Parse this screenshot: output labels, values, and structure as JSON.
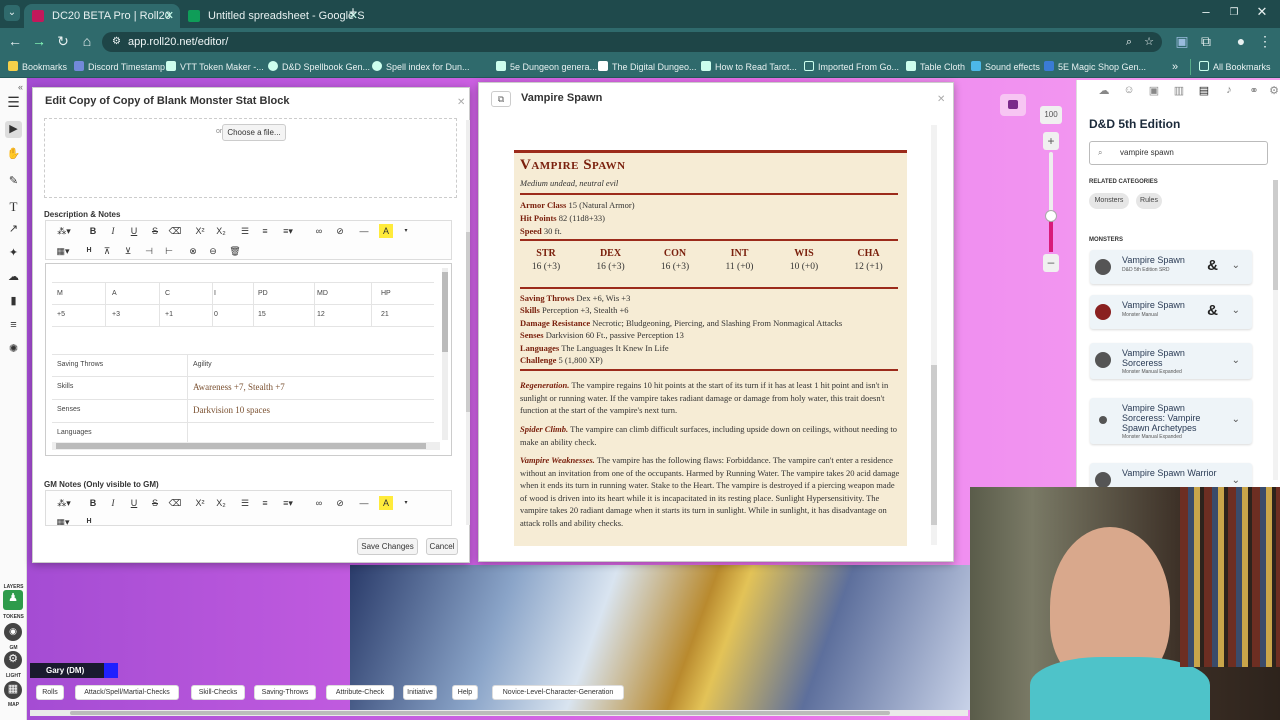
{
  "browser": {
    "tabs": [
      {
        "label": "DC20 BETA Pro | Roll20",
        "color": "#c2185b"
      },
      {
        "label": "Untitled spreadsheet - Google S",
        "color": "#0f9d58"
      }
    ],
    "new_tab": "+",
    "url": "app.roll20.net/editor/",
    "bookmarks": [
      "Bookmarks",
      "Discord Timestamp",
      "VTT Token Maker -...",
      "D&D Spellbook Gen...",
      "Spell index for Dun...",
      "5e Dungeon genera...",
      "The Digital Dungeo...",
      "How to Read Tarot...",
      "Imported From Go...",
      "Table Cloth",
      "Sound effects",
      "5E Magic Shop Gen...",
      "»",
      "All Bookmarks"
    ]
  },
  "editor": {
    "title": "Edit Copy of Copy of Blank Monster Stat Block",
    "or_label": "or",
    "choose_file": "Choose a file...",
    "desc_label": "Description & Notes",
    "table_headers": [
      "M",
      "A",
      "C",
      "I",
      "PD",
      "MD",
      "HP"
    ],
    "table_values": [
      "+5",
      "+3",
      "+1",
      "0",
      "15",
      "12",
      "21"
    ],
    "rows": [
      {
        "k": "Saving Throws",
        "v": "Agility"
      },
      {
        "k": "Skills",
        "v": "Awareness +7, Stealth +7"
      },
      {
        "k": "Senses",
        "v": "Darkvision 10 spaces"
      },
      {
        "k": "Languages",
        "v": ""
      }
    ],
    "gm_label": "GM Notes (Only visible to GM)",
    "save": "Save Changes",
    "cancel": "Cancel"
  },
  "handout": {
    "title": "Vampire Spawn",
    "name": "Vampire Spawn",
    "type": "Medium undead, neutral evil",
    "ac_k": "Armor Class",
    "ac_v": "15 (Natural Armor)",
    "hp_k": "Hit Points",
    "hp_v": "82 (11d8+33)",
    "sp_k": "Speed",
    "sp_v": "30 ft.",
    "abilities": [
      {
        "n": "STR",
        "v": "16 (+3)"
      },
      {
        "n": "DEX",
        "v": "16 (+3)"
      },
      {
        "n": "CON",
        "v": "16 (+3)"
      },
      {
        "n": "INT",
        "v": "11 (+0)"
      },
      {
        "n": "WIS",
        "v": "10 (+0)"
      },
      {
        "n": "CHA",
        "v": "12 (+1)"
      }
    ],
    "st_k": "Saving Throws",
    "st_v": "Dex +6, Wis +3",
    "sk_k": "Skills",
    "sk_v": "Perception +3, Stealth +6",
    "dr_k": "Damage Resistance",
    "dr_v": "Necrotic; Bludgeoning, Piercing, and Slashing From Nonmagical Attacks",
    "se_k": "Senses",
    "se_v": "Darkvision 60 Ft., passive Perception 13",
    "la_k": "Languages",
    "la_v": "The Languages It Knew In Life",
    "ch_k": "Challenge",
    "ch_v": "5 (1,800 XP)",
    "regen_k": "Regeneration.",
    "regen_v": "The vampire regains 10 hit points at the start of its turn if it has at least 1 hit point and isn't in sunlight or running water. If the vampire takes radiant damage or damage from holy water, this trait doesn't function at the start of the vampire's next turn.",
    "spider_k": "Spider Climb.",
    "spider_v": "The vampire can climb difficult surfaces, including upside down on ceilings, without needing to make an ability check.",
    "weak_k": "Vampire Weaknesses.",
    "weak_v": "The vampire has the following flaws: Forbiddance. The vampire can't enter a residence without an invitation from one of the occupants. Harmed by Running Water. The vampire takes 20 acid damage when it ends its turn in running water. Stake to the Heart. The vampire is destroyed if a piercing weapon made of wood is driven into its heart while it is incapacitated in its resting place. Sunlight Hypersensitivity. The vampire takes 20 radiant damage when it starts its turn in sunlight. While in sunlight, it has disadvantage on attack rolls and ability checks."
  },
  "zoom": "100",
  "compendium": {
    "title": "D&D 5th Edition",
    "search": "vampire spawn",
    "related": "RELATED CATEGORIES",
    "pills": [
      "Monsters",
      "Rules"
    ],
    "monsters_label": "MONSTERS",
    "cards": [
      {
        "name": "Vampire Spawn",
        "sub": "D&D 5th Edition SRD",
        "amp": true
      },
      {
        "name": "Vampire Spawn",
        "sub": "Monster Manual",
        "amp": true
      },
      {
        "name": "Vampire Spawn Sorceress",
        "sub": "Monster Manual Expanded",
        "amp": false
      },
      {
        "name": "Vampire Spawn Sorceress: Vampire Spawn Archetypes",
        "sub": "Monster Manual Expanded",
        "amp": false
      },
      {
        "name": "Vampire Spawn Warrior",
        "sub": "",
        "amp": false
      }
    ]
  },
  "left_labels": {
    "layers": "LAYERS",
    "tokens": "TOKENS",
    "gm": "GM",
    "light": "LIGHT",
    "map": "MAP"
  },
  "player": "Gary (DM)",
  "macros": [
    "Rolls",
    "Attack/Spell/Martial-Checks",
    "Skill-Checks",
    "Saving-Throws",
    "Attribute-Check",
    "Initiative",
    "Help",
    "Novice-Level-Character-Generation"
  ]
}
